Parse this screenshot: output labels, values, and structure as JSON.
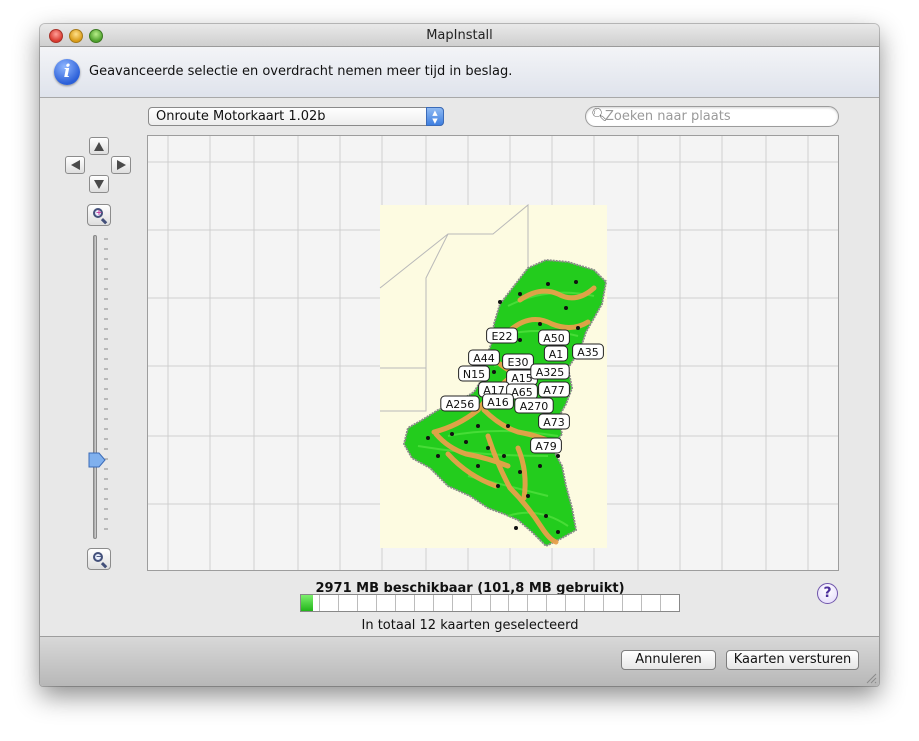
{
  "window": {
    "title": "MapInstall"
  },
  "info_bar": {
    "icon": "info-icon",
    "text": "Geavanceerde selectie en overdracht nemen meer tijd in beslag."
  },
  "map_select": {
    "selected": "Onroute Motorkaart 1.02b"
  },
  "search": {
    "placeholder": "Zoeken naar plaats",
    "value": ""
  },
  "navigation": {
    "icons": [
      "arrow-up-icon",
      "arrow-left-icon",
      "arrow-right-icon",
      "arrow-down-icon",
      "zoom-in-icon",
      "zoom-out-icon"
    ],
    "zoom_level_fraction": 0.74
  },
  "map": {
    "road_labels": [
      "E22",
      "A50",
      "A44",
      "E30",
      "A1",
      "A35",
      "N15",
      "A15",
      "A325",
      "A17",
      "A65",
      "A77",
      "A256",
      "A16",
      "A270",
      "A73",
      "A79"
    ],
    "colors": {
      "road_network": "#22cc1c",
      "highway": "#e8a14a",
      "tile_background": "#fdfbe1"
    }
  },
  "storage": {
    "summary": "2971 MB beschikbaar (101,8 MB gebruikt)",
    "used_fraction": 0.033,
    "segments": 20,
    "bar_color": "#2dc126"
  },
  "selection": {
    "total_text": "In totaal 12 kaarten geselecteerd"
  },
  "help": {
    "label": "?"
  },
  "buttons": {
    "cancel": "Annuleren",
    "send": "Kaarten versturen"
  }
}
